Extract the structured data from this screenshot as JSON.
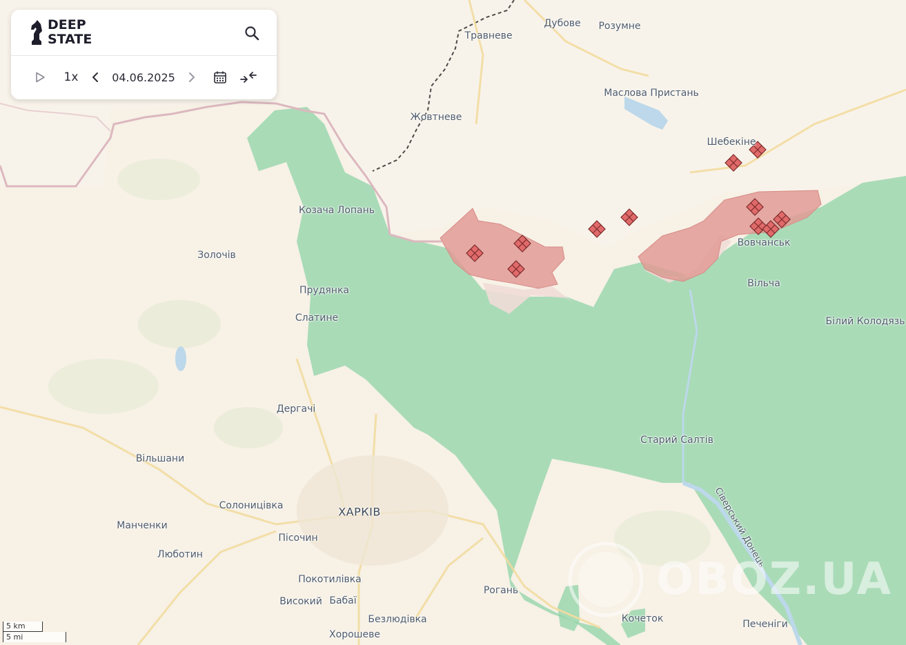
{
  "app": {
    "logo_line1": "DEEP",
    "logo_line2": "STATE",
    "speed": "1x",
    "date": "04.06.2025"
  },
  "icons": [
    "play-icon",
    "prev-icon",
    "next-icon",
    "calendar-icon",
    "compare-icon",
    "search-icon",
    "globe-icon"
  ],
  "colors": {
    "ukraine_controlled": "#8fd3a7",
    "occupied": "#e29b96",
    "gray_zone": "#f1dcd8",
    "map_base": "#f7f1e6",
    "water": "#bcd8ea",
    "marker": "#e06a6a"
  },
  "labels": [
    {
      "id": "travneve",
      "text": "Травневе"
    },
    {
      "id": "dubove",
      "text": "Дубове"
    },
    {
      "id": "rozumne",
      "text": "Розумне"
    },
    {
      "id": "maslova",
      "text": "Маслова Пристань"
    },
    {
      "id": "zhovtneve",
      "text": "Жовтневе"
    },
    {
      "id": "shebekyne",
      "text": "Шебекіне"
    },
    {
      "id": "kozacha",
      "text": "Козача Лопань"
    },
    {
      "id": "vovchansk",
      "text": "Вовчанськ"
    },
    {
      "id": "zolochiv",
      "text": "Золочів"
    },
    {
      "id": "prudyanka",
      "text": "Прудянка"
    },
    {
      "id": "vilcha",
      "text": "Вільча"
    },
    {
      "id": "slatyne",
      "text": "Слатине"
    },
    {
      "id": "bilyi",
      "text": "Білий Колодязь"
    },
    {
      "id": "derhachi",
      "text": "Дергачі"
    },
    {
      "id": "staryi",
      "text": "Старий Салтів"
    },
    {
      "id": "vilshany",
      "text": "Вільшани"
    },
    {
      "id": "solonytsivka",
      "text": "Солоницівка"
    },
    {
      "id": "kharkiv",
      "text": "ХАРКІВ"
    },
    {
      "id": "manchenky",
      "text": "Манченки"
    },
    {
      "id": "pisochyn",
      "text": "Пісочин"
    },
    {
      "id": "liubotyn",
      "text": "Люботин"
    },
    {
      "id": "pokotylivka",
      "text": "Покотилівка"
    },
    {
      "id": "rohan",
      "text": "Рогань"
    },
    {
      "id": "vysokyi",
      "text": "Високий"
    },
    {
      "id": "babai",
      "text": "Бабаї"
    },
    {
      "id": "bezliudivka",
      "text": "Безлюдівка"
    },
    {
      "id": "kochetok",
      "text": "Кочеток"
    },
    {
      "id": "khoroshev",
      "text": "Хорошеве"
    },
    {
      "id": "pechenihy",
      "text": "Печеніги"
    }
  ],
  "river_label": "Сіверський Донець",
  "scale": {
    "km": "5 km",
    "mi": "5 mi"
  },
  "watermark": "OBOZ.UA"
}
